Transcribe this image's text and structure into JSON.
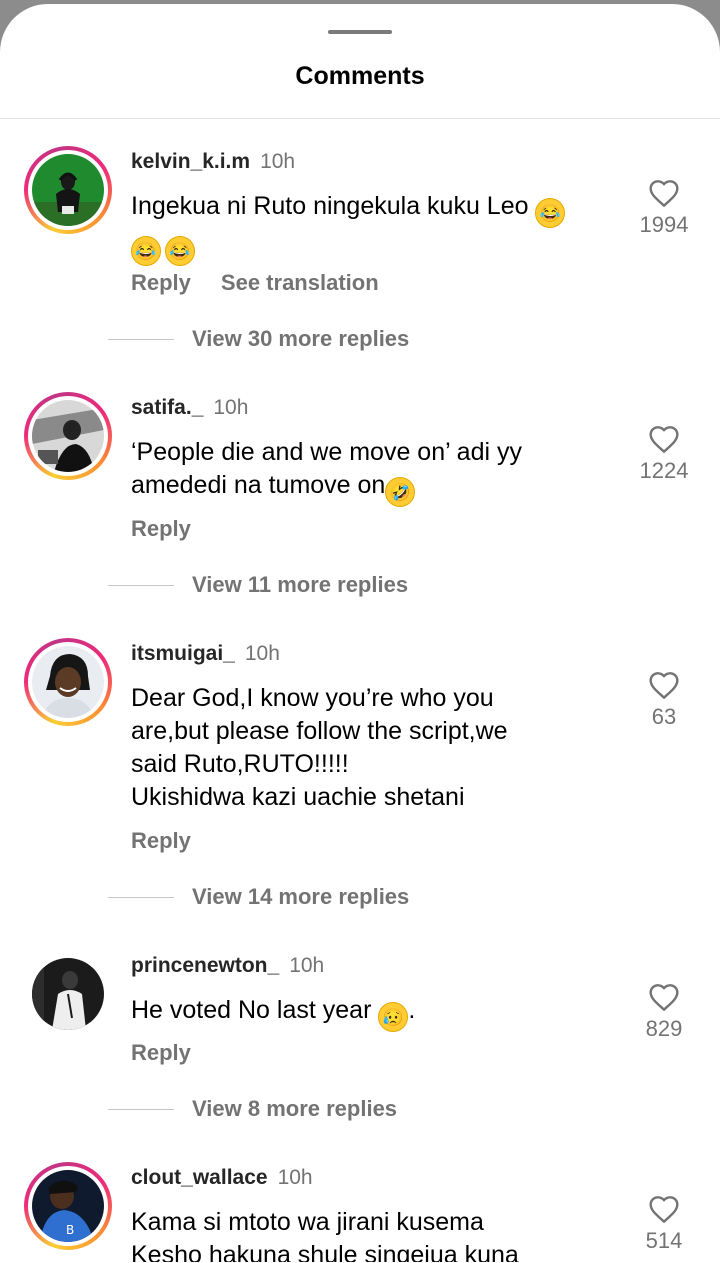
{
  "header": {
    "title": "Comments"
  },
  "comments": [
    {
      "username": "kelvin_k.i.m",
      "time": "10h",
      "text_lines": [
        "Ingekua ni Ruto ningekula kuku Leo",
        ""
      ],
      "likes": "1994",
      "reply_label": "Reply",
      "translate_label": "See translation",
      "view_replies": "View 30 more replies"
    },
    {
      "username": "satifa._",
      "time": "10h",
      "text_lines": [
        "‘People die and we move on’ adi yy",
        "amededi na tumove on"
      ],
      "likes": "1224",
      "reply_label": "Reply",
      "view_replies": "View 11 more replies"
    },
    {
      "username": "itsmuigai_",
      "time": "10h",
      "text_lines": [
        "Dear God,I know you’re who you",
        "are,but please follow the script,we",
        "said Ruto,RUTO!!!!!",
        "Ukishidwa kazi uachie shetani"
      ],
      "likes": "63",
      "reply_label": "Reply",
      "view_replies": "View 14 more replies"
    },
    {
      "username": "princenewton_",
      "time": "10h",
      "text_lines": [
        "He voted No last year",
        "."
      ],
      "likes": "829",
      "reply_label": "Reply",
      "view_replies": "View 8 more replies"
    },
    {
      "username": "clout_wallace",
      "time": "10h",
      "text_lines": [
        "Kama si mtoto wa jirani kusema",
        "Kesho hakuna shule singejua kuna"
      ],
      "likes": "514"
    }
  ],
  "icons": {
    "like": "heart-outline-icon",
    "laugh_emoji": "face-with-tears-of-joy",
    "rofl_emoji": "rolling-on-floor-laughing",
    "sad_emoji": "sad-but-relieved-face"
  },
  "colors": {
    "story_ring_start": "#f9ce34",
    "story_ring_mid": "#ee2a7b",
    "story_ring_end": "#c13584",
    "secondary_text": "#737373"
  }
}
